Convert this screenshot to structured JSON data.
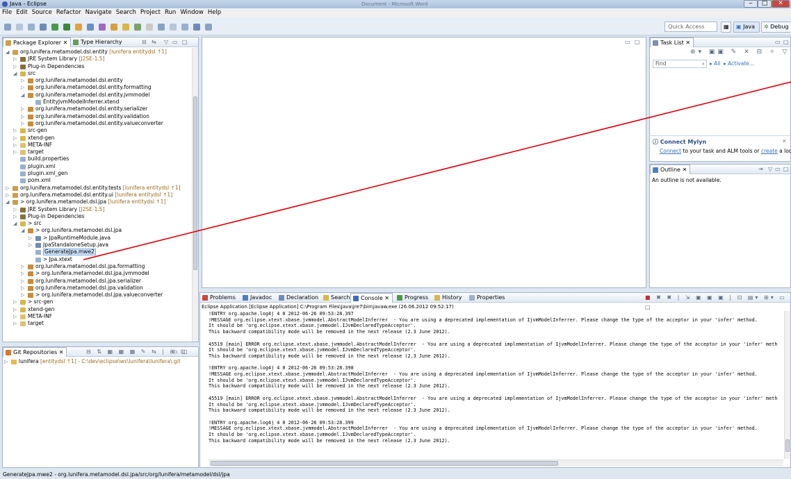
{
  "window": {
    "title": "Java - Eclipse",
    "center_title": "Document - Microsoft Word",
    "min": "‒",
    "max": "□",
    "close": "✕"
  },
  "menu": [
    "File",
    "Edit",
    "Source",
    "Refactor",
    "Navigate",
    "Search",
    "Project",
    "Run",
    "Window",
    "Help"
  ],
  "toolbar": {
    "quick_access_placeholder": "Quick Access",
    "perspective_java": "Java",
    "perspective_debug": "Debug"
  },
  "package_explorer": {
    "tabs": [
      "Package Explorer",
      "Type Hierarchy"
    ],
    "rows": [
      {
        "d": 0,
        "ar": "◢",
        "ic": "prj",
        "label": "org.lunifera.metamodel.dsl.entity",
        "ann": " [lunifera entitydsl ↑1]"
      },
      {
        "d": 1,
        "ar": "▷",
        "ic": "lib",
        "label": "JRE System Library",
        "ann": " [J2SE-1.5]"
      },
      {
        "d": 1,
        "ar": "▷",
        "ic": "lib",
        "label": "Plug-in Dependencies",
        "ann": ""
      },
      {
        "d": 1,
        "ar": "◢",
        "ic": "src",
        "label": "src",
        "ann": ""
      },
      {
        "d": 2,
        "ar": "▷",
        "ic": "pkg",
        "label": "org.lunifera.metamodel.dsl.entity",
        "ann": ""
      },
      {
        "d": 2,
        "ar": "▷",
        "ic": "pkg",
        "label": "org.lunifera.metamodel.dsl.entity.formatting",
        "ann": ""
      },
      {
        "d": 2,
        "ar": "◢",
        "ic": "pkg",
        "label": "org.lunifera.metamodel.dsl.entity.jvmmodel",
        "ann": ""
      },
      {
        "d": 3,
        "ar": "",
        "ic": "file",
        "label": "EntityJvmModelInferrer.xtend",
        "ann": ""
      },
      {
        "d": 2,
        "ar": "▷",
        "ic": "pkg",
        "label": "org.lunifera.metamodel.dsl.entity.serializer",
        "ann": ""
      },
      {
        "d": 2,
        "ar": "▷",
        "ic": "pkg",
        "label": "org.lunifera.metamodel.dsl.entity.validation",
        "ann": ""
      },
      {
        "d": 2,
        "ar": "▷",
        "ic": "pkg",
        "label": "org.lunifera.metamodel.dsl.entity.valueconverter",
        "ann": ""
      },
      {
        "d": 1,
        "ar": "▷",
        "ic": "src",
        "label": "src-gen",
        "ann": ""
      },
      {
        "d": 1,
        "ar": "▷",
        "ic": "src",
        "label": "xtend-gen",
        "ann": ""
      },
      {
        "d": 1,
        "ar": "▷",
        "ic": "fld",
        "label": "META-INF",
        "ann": ""
      },
      {
        "d": 1,
        "ar": "▷",
        "ic": "fld",
        "label": "target",
        "ann": ""
      },
      {
        "d": 1,
        "ar": "",
        "ic": "file",
        "label": "build.properties",
        "ann": ""
      },
      {
        "d": 1,
        "ar": "",
        "ic": "file",
        "label": "plugin.xml",
        "ann": ""
      },
      {
        "d": 1,
        "ar": "",
        "ic": "file",
        "label": "plugin.xml_gen",
        "ann": ""
      },
      {
        "d": 1,
        "ar": "",
        "ic": "file",
        "label": "pom.xml",
        "ann": ""
      },
      {
        "d": 0,
        "ar": "▷",
        "ic": "prj",
        "label": "org.lunifera.metamodel.dsl.entity.tests",
        "ann": " [lunifera entitydsl ↑1]"
      },
      {
        "d": 0,
        "ar": "▷",
        "ic": "prj",
        "label": "org.lunifera.metamodel.dsl.entity.ui",
        "ann": " [lunifera entitydsl ↑1]"
      },
      {
        "d": 0,
        "ar": "◢",
        "ic": "prj",
        "label": "> org.lunifera.metamodel.dsl.jpa",
        "ann": " [lunifera entitydsl ↑1]"
      },
      {
        "d": 1,
        "ar": "▷",
        "ic": "lib",
        "label": "JRE System Library",
        "ann": " [J2SE-1.5]"
      },
      {
        "d": 1,
        "ar": "▷",
        "ic": "lib",
        "label": "Plug-in Dependencies",
        "ann": ""
      },
      {
        "d": 1,
        "ar": "◢",
        "ic": "src",
        "label": "> src",
        "ann": ""
      },
      {
        "d": 2,
        "ar": "◢",
        "ic": "pkg",
        "label": "> org.lunifera.metamodel.dsl.jpa",
        "ann": ""
      },
      {
        "d": 3,
        "ar": "▷",
        "ic": "java",
        "label": "> JpaRuntimeModule.java",
        "ann": ""
      },
      {
        "d": 3,
        "ar": "▷",
        "ic": "java",
        "label": "JpaStandaloneSetup.java",
        "ann": ""
      },
      {
        "d": 3,
        "ar": "",
        "ic": "file",
        "label": "GenerateJpa.mwe2",
        "ann": "",
        "sel": true
      },
      {
        "d": 3,
        "ar": "",
        "ic": "file",
        "label": "> Jpa.xtext",
        "ann": ""
      },
      {
        "d": 2,
        "ar": "▷",
        "ic": "pkg",
        "label": "org.lunifera.metamodel.dsl.jpa.formatting",
        "ann": ""
      },
      {
        "d": 2,
        "ar": "▷",
        "ic": "pkg",
        "label": "> org.lunifera.metamodel.dsl.jpa.jvmmodel",
        "ann": ""
      },
      {
        "d": 2,
        "ar": "▷",
        "ic": "pkg",
        "label": "org.lunifera.metamodel.dsl.jpa.serializer",
        "ann": ""
      },
      {
        "d": 2,
        "ar": "▷",
        "ic": "pkg",
        "label": "org.lunifera.metamodel.dsl.jpa.validation",
        "ann": ""
      },
      {
        "d": 2,
        "ar": "▷",
        "ic": "pkg",
        "label": "> org.lunifera.metamodel.dsl.jpa.valueconverter",
        "ann": ""
      },
      {
        "d": 1,
        "ar": "▷",
        "ic": "src",
        "label": "> src-gen",
        "ann": ""
      },
      {
        "d": 1,
        "ar": "▷",
        "ic": "src",
        "label": "xtend-gen",
        "ann": ""
      },
      {
        "d": 1,
        "ar": "▷",
        "ic": "fld",
        "label": "META-INF",
        "ann": ""
      },
      {
        "d": 1,
        "ar": "▷",
        "ic": "fld",
        "label": "target",
        "ann": ""
      }
    ]
  },
  "git": {
    "tab": "Git Repositories",
    "repo": "lunifera",
    "repo_ann": " [entitydsl ↑1] - C:\\dev\\eclipse\\ws\\lunifera\\lunifera\\.git"
  },
  "tasklist": {
    "tab": "Task List",
    "find_placeholder": "Find",
    "all": "All",
    "activate": "Activate..."
  },
  "mylyn": {
    "title": "Connect Mylyn",
    "link1": "Connect",
    "text": " to your task and ALM tools or ",
    "link2": "create",
    "text2": " a local task."
  },
  "outline": {
    "tab": "Outline",
    "message": "An outline is not available."
  },
  "bottom_tabs": [
    "Problems",
    "Javadoc",
    "Declaration",
    "Search",
    "Console",
    "Progress",
    "History",
    "Properties"
  ],
  "console": {
    "header": "Eclipse Application [Eclipse Application] C:\\Program Files\\Java\\jre7\\bin\\javaw.exe (26.06.2012 09:52:17)",
    "text": "!ENTRY org.apache.log4j 4 0 2012-06-26 09:53:28.397\n!MESSAGE org.eclipse.xtext.xbase.jvmmodel.AbstractModelInferrer  - You are using a deprecated implementation of IjvmModelInferrer. Please change the type of the acceptor in your 'infer' method.\nIt should be 'org.eclipse.xtext.xbase.jvmmodel.IJvmDeclaredTypeAcceptor'.\nThis backward compatibility mode will be removed in the next release (2.3 June 2012).\n\n45519 [main] ERROR org.eclipse.xtext.xbase.jvmmodel.AbstractModelInferrer  - You are using a deprecated implementation of IjvmModelInferrer. Please change the type of the acceptor in your 'infer' meth\nIt should be 'org.eclipse.xtext.xbase.jvmmodel.IJvmDeclaredTypeAcceptor'.\nThis backward compatibility mode will be removed in the next release (2.3 June 2012).\n\n!ENTRY org.apache.log4j 4 0 2012-06-26 09:53:28.398\n!MESSAGE org.eclipse.xtext.xbase.jvmmodel.AbstractModelInferrer  - You are using a deprecated implementation of IjvmModelInferrer. Please change the type of the acceptor in your 'infer' method.\nIt should be 'org.eclipse.xtext.xbase.jvmmodel.IJvmDeclaredTypeAcceptor'.\nThis backward compatibility mode will be removed in the next release (2.3 June 2012).\n\n45519 [main] ERROR org.eclipse.xtext.xbase.jvmmodel.AbstractModelInferrer  - You are using a deprecated implementation of IjvmModelInferrer. Please change the type of the acceptor in your 'infer' meth\nIt should be 'org.eclipse.xtext.xbase.jvmmodel.IJvmDeclaredTypeAcceptor'.\nThis backward compatibility mode will be removed in the next release (2.3 June 2012).\n\n!ENTRY org.apache.log4j 4 0 2012-06-26 09:53:28.399\n!MESSAGE org.eclipse.xtext.xbase.jvmmodel.AbstractModelInferrer  - You are using a deprecated implementation of IjvmModelInferrer. Please change the type of the acceptor in your 'infer' method.\nIt should be 'org.eclipse.xtext.xbase.jvmmodel.IJvmDeclaredTypeAcceptor'.\nThis backward compatibility mode will be removed in the next release (2.3 June 2012)."
  },
  "status": "GenerateJpa.mwe2 - org.lunifera.metamodel.dsl.jpa/src/org/lunifera/metamodel/dsl/jpa",
  "colors": {
    "arrow": "#e0000a",
    "accent": "#3a6fb8",
    "selection": "#cfe3fb"
  }
}
